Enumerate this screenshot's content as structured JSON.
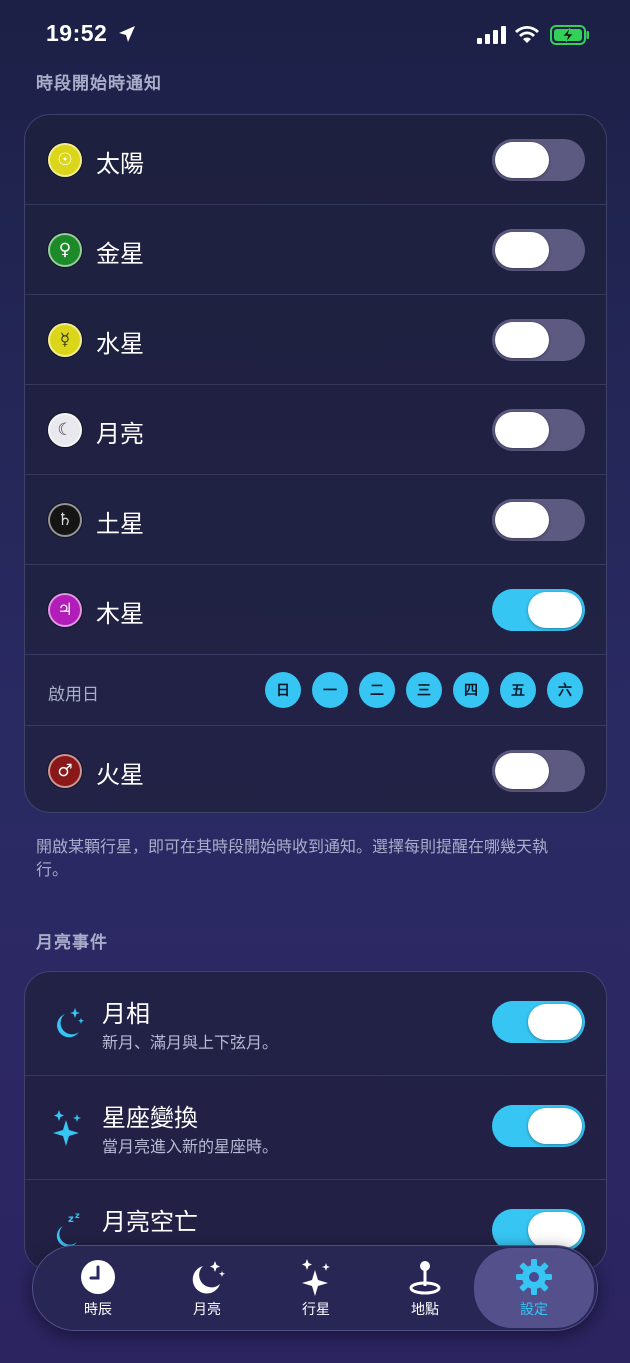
{
  "status_bar": {
    "time": "19:52"
  },
  "planet_section": {
    "title": "時段開始時通知",
    "planets": [
      {
        "label": "太陽",
        "symbol": "☉",
        "icon": "sun-icon",
        "color": "#dcd61a",
        "fg": "#ffffff",
        "on": false
      },
      {
        "label": "金星",
        "symbol": "♀",
        "icon": "venus-icon",
        "color": "#1d8a2a",
        "fg": "#ffffff",
        "on": false
      },
      {
        "label": "水星",
        "symbol": "☿",
        "icon": "mercury-icon",
        "color": "#dcd61a",
        "fg": "#3a3a10",
        "on": false
      },
      {
        "label": "月亮",
        "symbol": "☾",
        "icon": "moon-icon",
        "color": "#e8e8ee",
        "fg": "#444444",
        "on": false
      },
      {
        "label": "土星",
        "symbol": "♄",
        "icon": "saturn-icon",
        "color": "#151515",
        "fg": "#dddddd",
        "on": false
      },
      {
        "label": "木星",
        "symbol": "♃",
        "icon": "jupiter-icon",
        "color": "#b21cb8",
        "fg": "#ffffff",
        "on": true
      }
    ],
    "days": {
      "label": "啟用日",
      "items": [
        "日",
        "一",
        "二",
        "三",
        "四",
        "五",
        "六"
      ]
    },
    "mars": {
      "label": "火星",
      "symbol": "♂",
      "icon": "mars-icon",
      "color": "#8a1818",
      "fg": "#ffffff",
      "on": false
    },
    "footnote": "開啟某顆行星，即可在其時段開始時收到通知。選擇每則提醒在哪幾天執行。"
  },
  "moon_section": {
    "title": "月亮事件",
    "items": [
      {
        "title": "月相",
        "subtitle": "新月、滿月與上下弦月。",
        "icon": "moon-stars-icon",
        "on": true
      },
      {
        "title": "星座變換",
        "subtitle": "當月亮進入新的星座時。",
        "icon": "sparkles-icon",
        "on": true
      },
      {
        "title": "月亮空亡",
        "subtitle": "",
        "icon": "moon-zzz-icon",
        "on": true
      }
    ]
  },
  "tabbar": {
    "tabs": [
      {
        "label": "時辰",
        "icon": "clock-icon",
        "active": false
      },
      {
        "label": "月亮",
        "icon": "moon-stars-icon",
        "active": false
      },
      {
        "label": "行星",
        "icon": "sparkles-icon",
        "active": false
      },
      {
        "label": "地點",
        "icon": "location-pin-icon",
        "active": false
      },
      {
        "label": "設定",
        "icon": "gear-icon",
        "active": true
      }
    ]
  },
  "colors": {
    "accent": "#37c5f3",
    "toggle_off": "#5d5a82",
    "secondary_text": "#a9adc9"
  }
}
